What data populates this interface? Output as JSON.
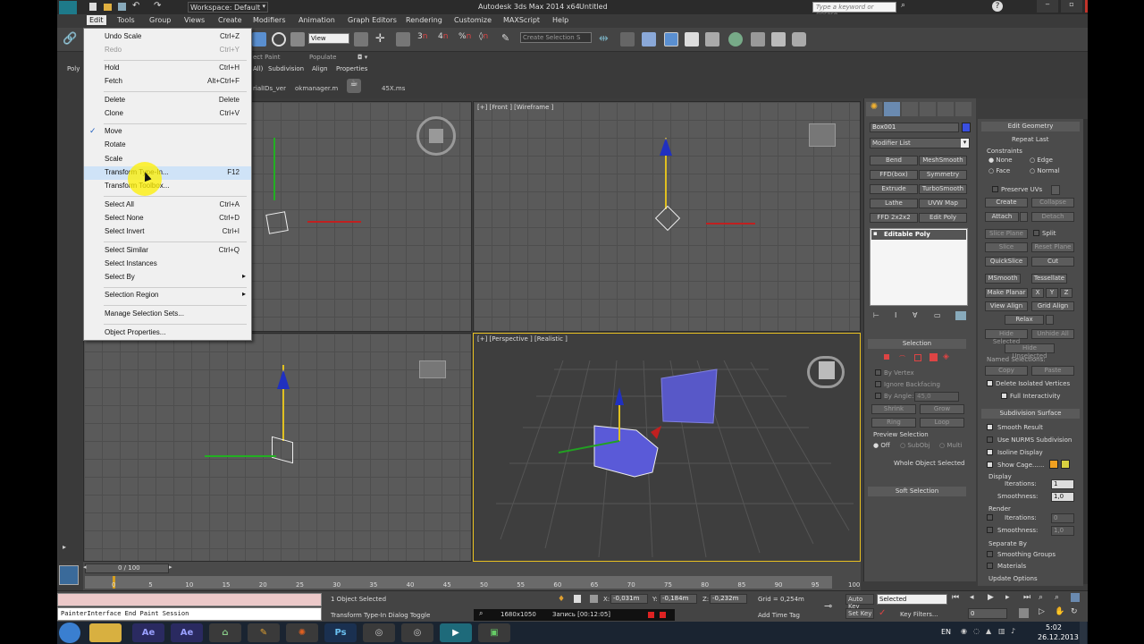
{
  "title_bar": {
    "workspace": "Workspace: Default",
    "app_title": "Autodesk 3ds Max 2014 x64",
    "file_name": "Untitled",
    "search_placeholder": "Type a keyword or phrase"
  },
  "menu": {
    "items": [
      "Edit",
      "Tools",
      "Group",
      "Views",
      "Create",
      "Modifiers",
      "Animation",
      "Graph Editors",
      "Rendering",
      "Customize",
      "MAXScript",
      "Help"
    ]
  },
  "toolbar": {
    "view_dropdown": "View",
    "selection_set_placeholder": "Create Selection S"
  },
  "ribbon": {
    "tabs": [
      "ect Paint",
      "Populate"
    ],
    "subtabs": [
      "All)",
      "Subdivision",
      "Align",
      "Properties"
    ],
    "left_labels": [
      "Poly"
    ],
    "file_tabs": [
      "rialIDs_ver",
      "okmanager.m",
      "45X.ms"
    ]
  },
  "edit_menu": {
    "items": [
      {
        "label": "Undo Scale",
        "shortcut": "Ctrl+Z",
        "disabled": false
      },
      {
        "label": "Redo",
        "shortcut": "Ctrl+Y",
        "disabled": true
      },
      {
        "label": "Hold",
        "shortcut": "Ctrl+H",
        "disabled": false
      },
      {
        "label": "Fetch",
        "shortcut": "Alt+Ctrl+F",
        "disabled": false
      },
      {
        "label": "Delete",
        "shortcut": "Delete",
        "disabled": false
      },
      {
        "label": "Clone",
        "shortcut": "Ctrl+V",
        "disabled": false
      },
      {
        "label": "Move",
        "shortcut": "",
        "checked": true
      },
      {
        "label": "Rotate",
        "shortcut": ""
      },
      {
        "label": "Scale",
        "shortcut": ""
      },
      {
        "label": "Transform Type-In...",
        "shortcut": "F12",
        "highlighted": true
      },
      {
        "label": "Transform Toolbox...",
        "shortcut": ""
      },
      {
        "label": "Select All",
        "shortcut": "Ctrl+A"
      },
      {
        "label": "Select None",
        "shortcut": "Ctrl+D"
      },
      {
        "label": "Select Invert",
        "shortcut": "Ctrl+I"
      },
      {
        "label": "Select Similar",
        "shortcut": "Ctrl+Q"
      },
      {
        "label": "Select Instances",
        "shortcut": ""
      },
      {
        "label": "Select By",
        "shortcut": "",
        "submenu": true
      },
      {
        "label": "Selection Region",
        "shortcut": "",
        "submenu": true
      },
      {
        "label": "Manage Selection Sets...",
        "shortcut": ""
      },
      {
        "label": "Object Properties...",
        "shortcut": ""
      }
    ],
    "check_mark": "✓",
    "submenu_arrow": "▸"
  },
  "viewports": {
    "front_label": "[+] [Front ] [Wireframe ]",
    "perspective_label": "[+] [Perspective ] [Realistic ]"
  },
  "command_panel": {
    "object_name": "Box001",
    "modifier_list": "Modifier List",
    "modifier_buttons": [
      "Bend",
      "MeshSmooth",
      "FFD(box)",
      "Symmetry",
      "Extrude",
      "TurboSmooth",
      "Lathe",
      "UVW Map",
      "FFD 2x2x2",
      "Edit Poly"
    ],
    "stack_item": "Editable Poly",
    "selection_title": "Selection",
    "by_vertex": "By Vertex",
    "ignore_backfacing": "Ignore Backfacing",
    "by_angle": "By Angle:",
    "by_angle_value": "45,0",
    "shrink": "Shrink",
    "grow": "Grow",
    "ring": "Ring",
    "loop": "Loop",
    "preview_selection": "Preview Selection",
    "preview_options": [
      "Off",
      "SubObj",
      "Multi"
    ],
    "whole_object_selected": "Whole Object Selected",
    "soft_selection": "Soft Selection",
    "accent_color": "#3a4fe0"
  },
  "edit_geometry": {
    "title": "Edit Geometry",
    "repeat_last": "Repeat Last",
    "constraints": "Constraints",
    "constraint_options": [
      "None",
      "Edge",
      "Face",
      "Normal"
    ],
    "preserve_uvs": "Preserve UVs",
    "create": "Create",
    "collapse": "Collapse",
    "attach": "Attach",
    "detach": "Detach",
    "slice_plane": "Slice Plane",
    "split": "Split",
    "slice": "Slice",
    "reset_plane": "Reset Plane",
    "quickslice": "QuickSlice",
    "cut": "Cut",
    "msmooth": "MSmooth",
    "tessellate": "Tessellate",
    "make_planar": "Make Planar",
    "xyz": [
      "X",
      "Y",
      "Z"
    ],
    "view_align": "View Align",
    "grid_align": "Grid Align",
    "relax": "Relax",
    "hide_selected": "Hide Selected",
    "unhide_all": "Unhide All",
    "hide_unselected": "Hide Unselected",
    "named_selections": "Named Selections:",
    "copy": "Copy",
    "paste": "Paste",
    "delete_isolated": "Delete Isolated Vertices",
    "full_interactivity": "Full Interactivity"
  },
  "subdivision_surface": {
    "title": "Subdivision Surface",
    "smooth_result": "Smooth Result",
    "use_nurms": "Use NURMS Subdivision",
    "isoline_display": "Isoline Display",
    "show_cage": "Show Cage......",
    "cage_colors": [
      "#f0a020",
      "#d8d040"
    ],
    "display": "Display",
    "iterations_label": "Iterations:",
    "iterations_value": "1",
    "smoothness_label": "Smoothness:",
    "smoothness_value": "1,0",
    "render": "Render",
    "render_iterations": "0",
    "render_smoothness": "1,0",
    "separate_by": "Separate By",
    "smoothing_groups": "Smoothing Groups",
    "materials": "Materials",
    "update_options": "Update Options"
  },
  "timeline": {
    "frame_counter": "0 / 100",
    "ticks": [
      "0",
      "5",
      "10",
      "15",
      "20",
      "25",
      "30",
      "35",
      "40",
      "45",
      "50",
      "55",
      "60",
      "65",
      "70",
      "75",
      "80",
      "85",
      "90",
      "95",
      "100"
    ]
  },
  "status": {
    "script_listener": "PainterInterface End Paint Session",
    "objects_selected": "1 Object Selected",
    "prompt": "Transform Type-In Dialog Toggle",
    "x_label": "X:",
    "x_value": "-0,031m",
    "y_label": "Y:",
    "y_value": "-0,184m",
    "z_label": "Z:",
    "z_value": "-0,232m",
    "grid": "Grid = 0,254m",
    "add_time_tag": "Add Time Tag",
    "auto_key": "Auto Key",
    "set_key": "Set Key",
    "selected_dropdown": "Selected",
    "key_filters": "Key Filters...",
    "frame_field": "0",
    "recorder_resolution": "1680x1050",
    "recorder_label": "Запись [00:12:05]"
  },
  "taskbar": {
    "language": "EN",
    "time": "5:02",
    "date": "26.12.2013",
    "apps": [
      "Ae",
      "Ae",
      "Ps"
    ]
  }
}
